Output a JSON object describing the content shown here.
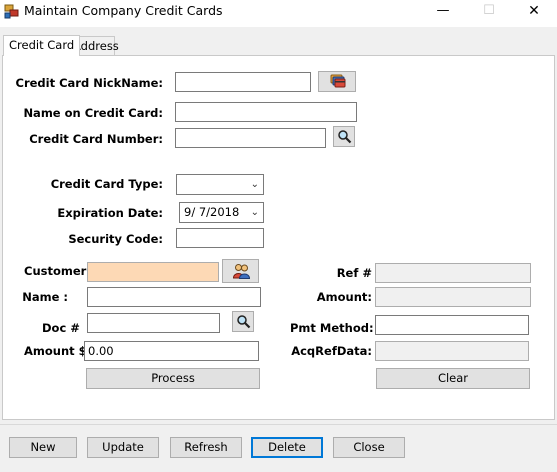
{
  "window": {
    "title": "Maintain Company Credit Cards",
    "minimize_glyph": "—",
    "maximize_glyph": "☐",
    "close_glyph": "✕"
  },
  "tabs": [
    {
      "label": "Credit Card",
      "active": true
    },
    {
      "label": "Address",
      "active": false
    }
  ],
  "card_form": {
    "nickname_label": "Credit Card NickName:",
    "nickname_value": "",
    "name_label": "Name on Credit Card:",
    "name_value": "",
    "number_label": "Credit Card Number:",
    "number_value": "",
    "type_label": "Credit Card Type:",
    "type_value": "",
    "expiration_label": "Expiration Date:",
    "expiration_value": "9/  7/2018",
    "security_label": "Security Code:",
    "security_value": ""
  },
  "transaction": {
    "customer_label": "Customer",
    "customer_value": "",
    "name_label": "Name :",
    "name_value": "",
    "doc_label": "Doc #",
    "doc_value": "",
    "amount_label": "Amount $",
    "amount_value": "0.00",
    "process_label": "Process",
    "ref_label": "Ref #",
    "ref_value": "",
    "amount_right_label": "Amount:",
    "amount_right_value": "",
    "pmt_method_label": "Pmt Method:",
    "pmt_method_value": "",
    "acq_ref_label": "AcqRefData:",
    "acq_ref_value": "",
    "clear_label": "Clear"
  },
  "footer": {
    "new_label": "New",
    "update_label": "Update",
    "refresh_label": "Refresh",
    "delete_label": "Delete",
    "close_label": "Close"
  },
  "icons": {
    "app": "app-window-icon",
    "card_picker": "credit-cards-icon",
    "search": "magnifier-icon",
    "customer_lookup": "people-icon"
  },
  "colors": {
    "customer_field_bg": "#fdd9b5",
    "focus_border": "#0078d7",
    "window_bg": "#f0f0f0"
  }
}
